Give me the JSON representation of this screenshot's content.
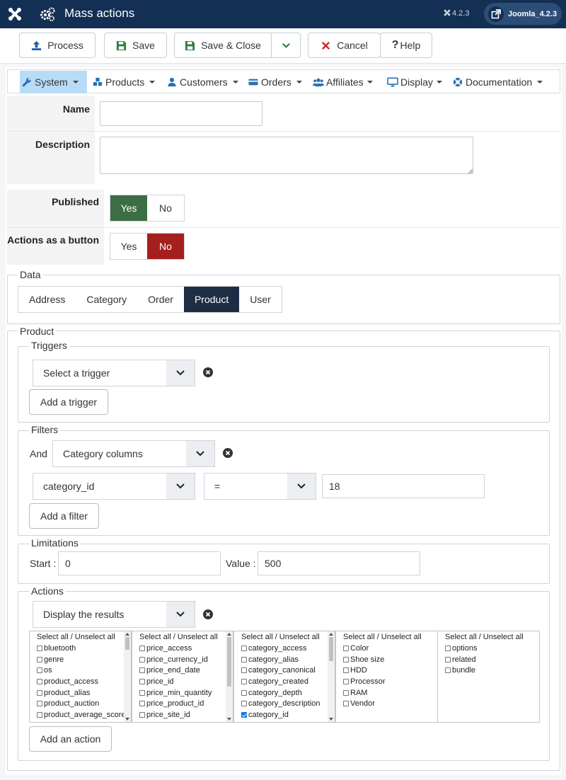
{
  "header": {
    "title": "Mass actions",
    "version": "4.2.3",
    "site_label": "Joomla_4.2.3"
  },
  "toolbar": {
    "process": "Process",
    "save": "Save",
    "save_close": "Save & Close",
    "cancel": "Cancel",
    "help": "Help"
  },
  "menu": {
    "items": [
      {
        "label": "System",
        "icon": "wrench-icon"
      },
      {
        "label": "Products",
        "icon": "cubes-icon"
      },
      {
        "label": "Customers",
        "icon": "user-icon"
      },
      {
        "label": "Orders",
        "icon": "credit-card-icon"
      },
      {
        "label": "Affiliates",
        "icon": "users-icon"
      },
      {
        "label": "Display",
        "icon": "monitor-icon"
      },
      {
        "label": "Documentation",
        "icon": "lifebuoy-icon"
      }
    ]
  },
  "form": {
    "name_label": "Name",
    "name_value": "",
    "description_label": "Description",
    "description_value": "",
    "published_label": "Published",
    "published": "Yes",
    "button_label": "Actions as a button",
    "as_button": "No",
    "yes": "Yes",
    "no": "No"
  },
  "data_section": {
    "legend": "Data",
    "tabs": [
      "Address",
      "Category",
      "Order",
      "Product",
      "User"
    ],
    "selected": "Product"
  },
  "product_section": {
    "legend": "Product",
    "triggers": {
      "legend": "Triggers",
      "select_value": "Select a trigger",
      "add_button": "Add a trigger"
    },
    "filters": {
      "legend": "Filters",
      "and_label": "And",
      "group_value": "Category columns",
      "column_value": "category_id",
      "operator_value": "=",
      "filter_value": "18",
      "add_button": "Add a filter"
    },
    "limitations": {
      "legend": "Limitations",
      "start_label": "Start :",
      "start_value": "0",
      "value_label": "Value :",
      "value_value": "500"
    },
    "actions": {
      "legend": "Actions",
      "select_value": "Display the results",
      "add_button": "Add an action",
      "select_all_label": "Select all / Unselect all",
      "lists": [
        {
          "options": [
            {
              "label": "bluetooth",
              "checked": false
            },
            {
              "label": "genre",
              "checked": false
            },
            {
              "label": "os",
              "checked": false
            },
            {
              "label": "product_access",
              "checked": false
            },
            {
              "label": "product_alias",
              "checked": false
            },
            {
              "label": "product_auction",
              "checked": false
            },
            {
              "label": "product_average_score",
              "checked": false
            }
          ]
        },
        {
          "options": [
            {
              "label": "price_access",
              "checked": false
            },
            {
              "label": "price_currency_id",
              "checked": false
            },
            {
              "label": "price_end_date",
              "checked": false
            },
            {
              "label": "price_id",
              "checked": false
            },
            {
              "label": "price_min_quantity",
              "checked": false
            },
            {
              "label": "price_product_id",
              "checked": false
            },
            {
              "label": "price_site_id",
              "checked": false
            }
          ]
        },
        {
          "options": [
            {
              "label": "category_access",
              "checked": false
            },
            {
              "label": "category_alias",
              "checked": false
            },
            {
              "label": "category_canonical",
              "checked": false
            },
            {
              "label": "category_created",
              "checked": false
            },
            {
              "label": "category_depth",
              "checked": false
            },
            {
              "label": "category_description",
              "checked": false
            },
            {
              "label": "category_id",
              "checked": true
            }
          ]
        },
        {
          "options": [
            {
              "label": "Color",
              "checked": false
            },
            {
              "label": "Shoe size",
              "checked": false
            },
            {
              "label": "HDD",
              "checked": false
            },
            {
              "label": "Processor",
              "checked": false
            },
            {
              "label": "RAM",
              "checked": false
            },
            {
              "label": "Vendor",
              "checked": false
            }
          ]
        },
        {
          "options": [
            {
              "label": "options",
              "checked": false
            },
            {
              "label": "related",
              "checked": false
            },
            {
              "label": "bundle",
              "checked": false
            }
          ]
        }
      ]
    }
  }
}
